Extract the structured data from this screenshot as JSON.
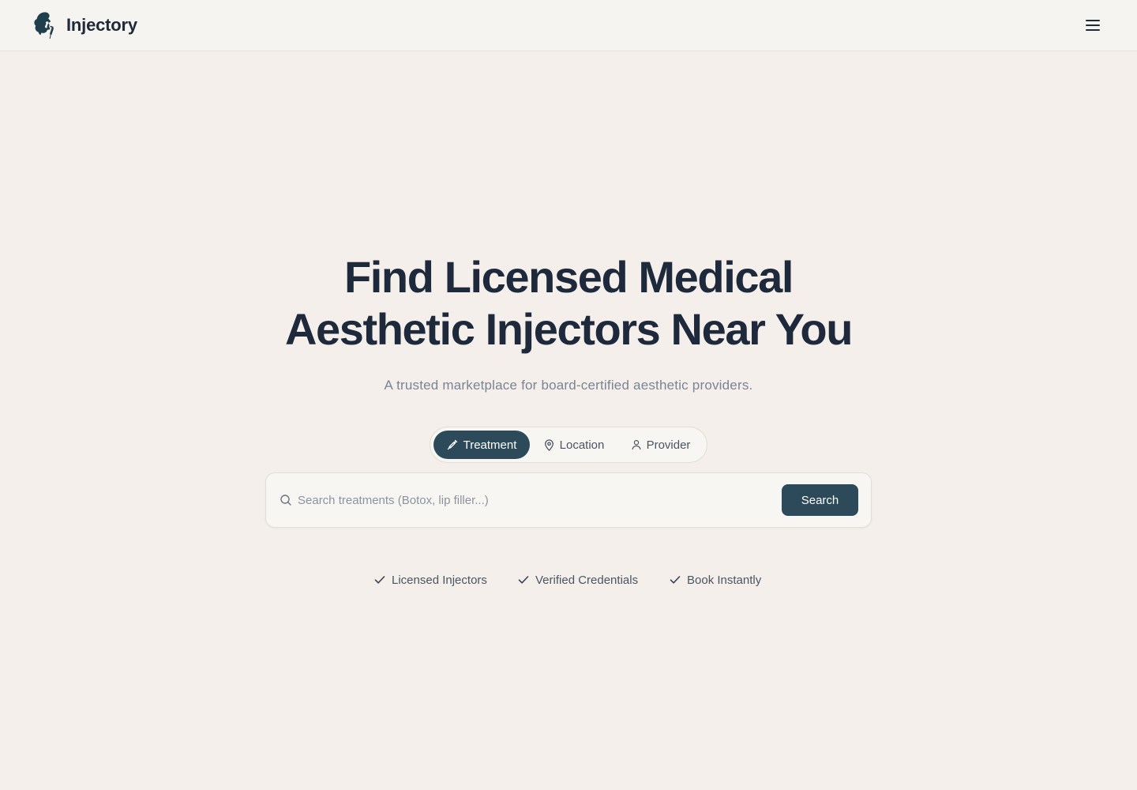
{
  "brand": {
    "name": "Injectory",
    "logo_icon": "woman-profile-syringe-logo"
  },
  "header": {
    "menu_icon": "hamburger-menu-icon"
  },
  "hero": {
    "title_line1": "Find Licensed Medical",
    "title_line2": "Aesthetic Injectors Near You",
    "subtitle": "A trusted marketplace for board-certified aesthetic providers."
  },
  "search_modes": {
    "active": "Treatment",
    "tabs": [
      {
        "label": "Treatment",
        "icon": "syringe-icon"
      },
      {
        "label": "Location",
        "icon": "map-pin-icon"
      },
      {
        "label": "Provider",
        "icon": "user-icon"
      }
    ]
  },
  "search": {
    "placeholder": "Search treatments (Botox, lip filler...)",
    "value": "",
    "button_label": "Search",
    "icon": "search-icon"
  },
  "badges": [
    {
      "label": "Licensed Injectors",
      "icon": "check-icon"
    },
    {
      "label": "Verified Credentials",
      "icon": "check-icon"
    },
    {
      "label": "Book Instantly",
      "icon": "check-icon"
    }
  ],
  "colors": {
    "page_background": "#f4efea",
    "header_background": "#f6f4f0",
    "primary": "#2c4a5a",
    "heading": "#1e293b",
    "muted_text": "#7b8494",
    "logo": "#1e3f4b"
  }
}
